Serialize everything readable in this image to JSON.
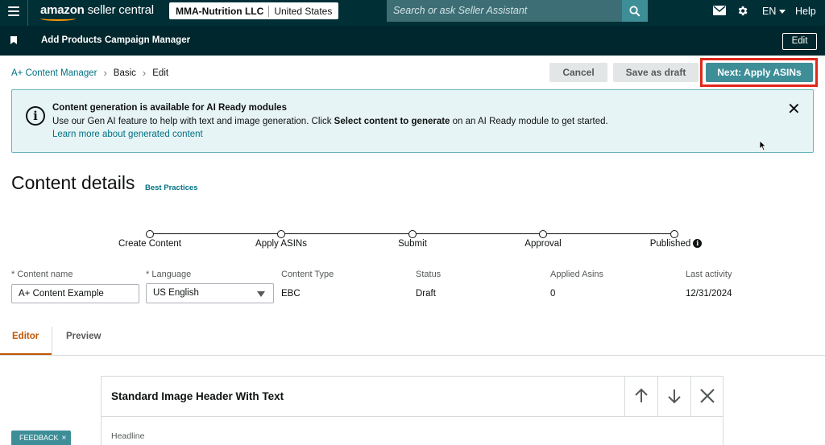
{
  "topnav": {
    "logo_main": "amazon",
    "logo_sub": " seller central",
    "account": "MMA-Nutrition LLC",
    "marketplace": "United States",
    "search_placeholder": "Search or ask Seller Assistant",
    "language": "EN",
    "help": "Help",
    "icons": [
      "menu-icon",
      "search-icon",
      "mail-icon",
      "gear-icon"
    ]
  },
  "bookmarks": {
    "items": [
      "Add Products",
      "Campaign Manager"
    ],
    "edit_label": "Edit"
  },
  "breadcrumb": {
    "items": [
      "A+ Content Manager",
      "Basic",
      "Edit"
    ]
  },
  "actions": {
    "cancel": "Cancel",
    "save_draft": "Save as draft",
    "next": "Next: Apply ASINs"
  },
  "banner": {
    "title": "Content generation is available for AI Ready modules",
    "body_before": "Use our Gen AI feature to help with text and image generation. Click ",
    "body_bold": "Select content to generate",
    "body_after": " on an AI Ready module to get started.",
    "link": "Learn more about generated content",
    "close": "✕"
  },
  "page": {
    "title": "Content details",
    "best_practices": "Best Practices"
  },
  "steps": [
    "Create Content",
    "Apply ASINs",
    "Submit",
    "Approval",
    "Published"
  ],
  "fields": {
    "content_name_label": "* Content name",
    "content_name_value": "A+ Content Example",
    "language_label": "* Language",
    "language_value": "US English",
    "content_type_label": "Content Type",
    "content_type_value": "EBC",
    "status_label": "Status",
    "status_value": "Draft",
    "applied_asins_label": "Applied Asins",
    "applied_asins_value": "0",
    "last_activity_label": "Last activity",
    "last_activity_value": "12/31/2024"
  },
  "tabs": [
    "Editor",
    "Preview"
  ],
  "module": {
    "title": "Standard Image Header With Text",
    "headline_label": "Headline"
  },
  "feedback": {
    "label": "FEEDBACK",
    "close": "×"
  },
  "colors": {
    "nav_bg": "#002f36",
    "accent": "#3e8e98",
    "link": "#007185",
    "active_tab": "#c45500",
    "highlight": "#e0281a"
  }
}
